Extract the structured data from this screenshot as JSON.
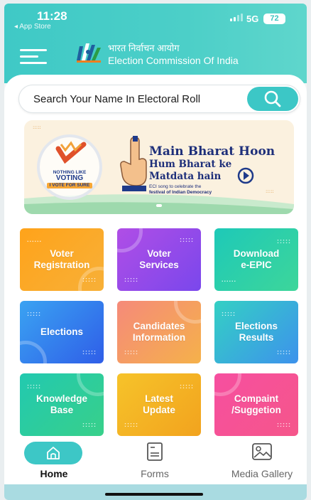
{
  "status_bar": {
    "time": "11:28",
    "back_label": "◂ App Store",
    "network": "5G",
    "battery": "72"
  },
  "header": {
    "title_hindi": "भारत निर्वाचन आयोग",
    "title_english": "Election Commission Of India"
  },
  "search": {
    "placeholder": "Search Your Name In Electoral Roll"
  },
  "banner": {
    "badge_line1": "NOTHING LIKE",
    "badge_line2": "VOTING",
    "badge_line3": "I VOTE FOR SURE",
    "headline": "Main Bharat Hoon",
    "subhead_line1": "Hum Bharat ke",
    "subhead_line2": "Matdata hain",
    "caption_line1": "ECI song to celebrate the",
    "caption_line2": "festival of Indian Democracy"
  },
  "tiles": [
    {
      "line1": "Voter",
      "line2": "Registration"
    },
    {
      "line1": "Voter",
      "line2": "Services"
    },
    {
      "line1": "Download",
      "line2": "e-EPIC"
    },
    {
      "line1": "Elections",
      "line2": ""
    },
    {
      "line1": "Candidates",
      "line2": "Information"
    },
    {
      "line1": "Elections",
      "line2": "Results"
    },
    {
      "line1": "Knowledge",
      "line2": "Base"
    },
    {
      "line1": "Latest",
      "line2": "Update"
    },
    {
      "line1": "Compaint",
      "line2": "/Suggetion"
    }
  ],
  "tabs": {
    "home": "Home",
    "forms": "Forms",
    "media": "Media Gallery"
  },
  "colors": {
    "accent": "#3cc7c6",
    "tile_orange": "#f59a1d",
    "tile_purple": "#8c4de9",
    "tile_teal": "#2fcfae",
    "tile_blue": "#3b7cf0"
  }
}
